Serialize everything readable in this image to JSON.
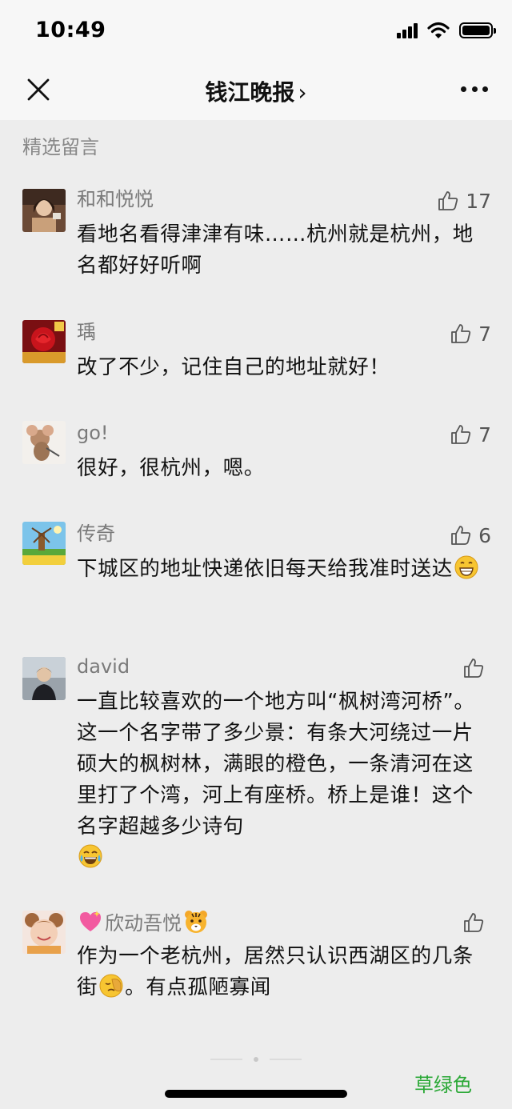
{
  "status_bar": {
    "time": "10:49"
  },
  "nav": {
    "title": "钱江晚报",
    "chevron": "›"
  },
  "section": {
    "title": "精选留言"
  },
  "comments": [
    {
      "name": "和和悦悦",
      "likes": "17",
      "text": "看地名看得津津有味……杭州就是杭州，地名都好好听啊"
    },
    {
      "name": "瑀",
      "likes": "7",
      "text": "改了不少，记住自己的地址就好！"
    },
    {
      "name": "go!",
      "likes": "7",
      "text": "很好，很杭州，嗯。"
    },
    {
      "name": "传奇",
      "likes": "6",
      "text_before": "下城区的地址快递依旧每天给我准时送达",
      "emoji": "grinning-face"
    },
    {
      "name": "david",
      "likes": "",
      "text_before": "一直比较喜欢的一个地方叫“枫树湾河桥”。这一个名字带了多少景：有条大河绕过一片硕大的枫树林，满眼的橙色，一条清河在这里打了个湾，河上有座桥。桥上是谁！这个名字超越多少诗句",
      "emoji": "tears-of-joy-face"
    },
    {
      "name": "欣动吾悦",
      "likes": "",
      "name_prefix_emoji": "sparkling-heart",
      "name_suffix_emoji": "tiger-face",
      "text_before": "作为一个老杭州，居然只认识西湖区的几条街",
      "emoji": "facepalm-face",
      "text_after": "。有点孤陋寡闻"
    }
  ],
  "footer": {
    "watermark": "草绿色"
  }
}
